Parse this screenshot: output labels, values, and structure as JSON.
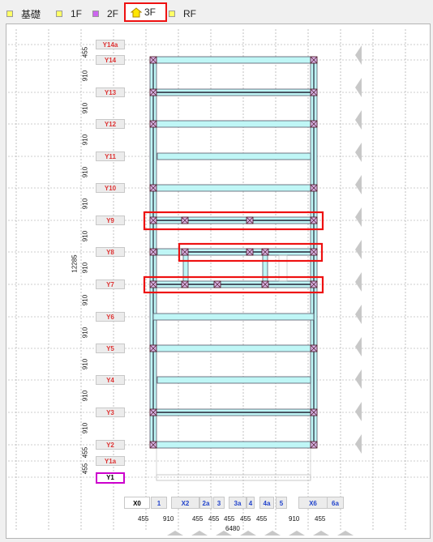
{
  "tabs": [
    {
      "label": "基礎",
      "swatch": "#ffff66"
    },
    {
      "label": "1F",
      "swatch": "#ffff66"
    },
    {
      "label": "2F",
      "swatch": "#cc66ee"
    },
    {
      "label": "3F",
      "swatch": "#ffff66",
      "active": true
    },
    {
      "label": "RF",
      "swatch": "#ffff66"
    }
  ],
  "y_grid": {
    "labels": [
      "Y14a",
      "Y14",
      "Y13",
      "Y12",
      "Y11",
      "Y10",
      "Y9",
      "Y8",
      "Y7",
      "Y6",
      "Y5",
      "Y4",
      "Y3",
      "Y2",
      "Y1a",
      "Y1"
    ],
    "active": "Y1",
    "dimensions": [
      "455",
      "910",
      "910",
      "910",
      "910",
      "910",
      "910",
      "910",
      "910",
      "910",
      "910",
      "910",
      "910",
      "455",
      "455"
    ],
    "total": "12285"
  },
  "x_grid": {
    "labels": [
      "X0",
      "1",
      "X2",
      "2a",
      "3",
      "3a",
      "4",
      "4a",
      "5",
      "X6",
      "6a"
    ],
    "active": "X0",
    "dimensions": [
      "455",
      "910",
      "455",
      "455",
      "455",
      "455",
      "455",
      "910",
      "455"
    ],
    "total": "6480"
  },
  "colors": {
    "beam_fill": "#bff6f6",
    "column": "#d9b4e8",
    "highlight": "#e11",
    "grid": "#9a9a9a"
  }
}
